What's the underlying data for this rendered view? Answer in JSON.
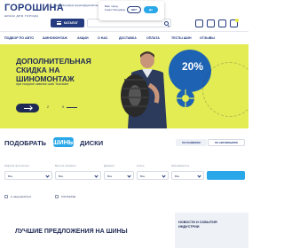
{
  "header": {
    "logo": "ГОРОШИНА",
    "logo_sub": "ШИНЫ ДЛЯ ГОРОДА",
    "city": "Санкт-Петербург",
    "email": "support@goroshina.ru",
    "catalog_label": "КАТАЛОГ",
    "search_placeholder": ""
  },
  "city_popup": {
    "question_line1": "Ваш город",
    "question_line2": "Санкт-Петербург",
    "no_label": "НЕТ",
    "yes_label": "ДА"
  },
  "nav": {
    "items": [
      "ПОДБОР ПО АВТО",
      "ШИНОМОНТАЖ",
      "АКЦИИ",
      "О НАС",
      "ДОСТАВКА",
      "ОПЛАТА",
      "ТЕСТЫ ШИН",
      "ОТЗЫВЫ"
    ]
  },
  "banner": {
    "title": "ДОПОЛНИТЕЛЬНАЯ СКИДКА НА ШИНОМОНТАЖ",
    "text": "при покупке зимних шин Toursider",
    "discount": "20%",
    "pager_current": "2",
    "pager_total": "9",
    "ring_text": "СКИДКА • СКИДКА • СКИДКА"
  },
  "selector": {
    "title": "ПОДОБРАТЬ",
    "tab_tires": "ШИНЫ",
    "tab_disks": "ДИСКИ",
    "mode_active": "ПО РАЗМЕРАМ",
    "mode_idle": "ПО АВТОМОБИЛЮ",
    "fields": [
      {
        "label": "Ширина протектора",
        "value": "Все"
      },
      {
        "label": "Высота профиля",
        "value": "Все"
      },
      {
        "label": "Диаметр",
        "value": "Все"
      },
      {
        "label": "Сезон",
        "value": "Все"
      },
      {
        "label": "Шипованность",
        "value": "Все"
      }
    ],
    "checks": [
      "С нагрузкой (шт)",
      "С/Z RunFlat"
    ]
  },
  "bottom": {
    "best_title": "ЛУЧШИЕ ПРЕДЛОЖЕНИЯ НА ШИНЫ",
    "news_title": "НОВОСТИ И СОБЫТИЯ ИНДУСТРИИ"
  },
  "colors": {
    "brand_blue": "#243b7f",
    "accent_cyan": "#29a7e8",
    "banner_yellow": "#e3ec52",
    "discount_blue": "#1e63b3"
  }
}
